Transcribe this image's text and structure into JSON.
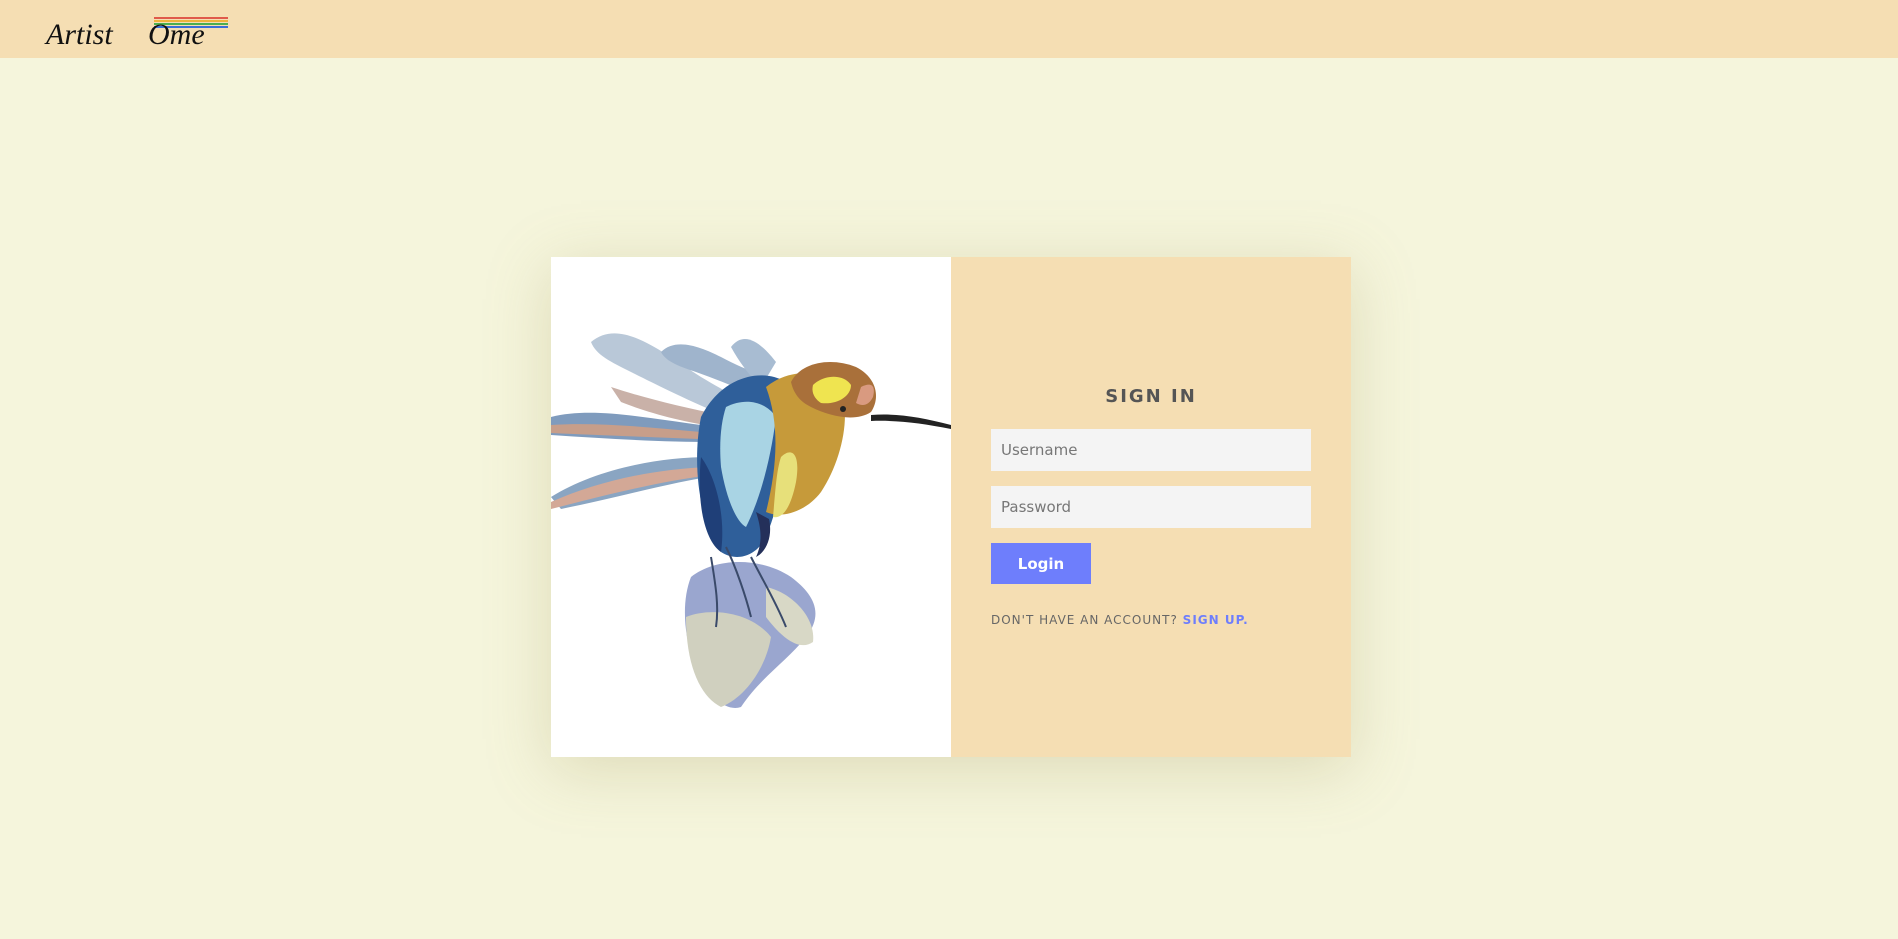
{
  "header": {
    "logo_text": "ArtistOme"
  },
  "login": {
    "title": "SIGN IN",
    "username_placeholder": "Username",
    "password_placeholder": "Password",
    "login_label": "Login",
    "prompt": "DON'T HAVE AN ACCOUNT?",
    "signup_label": "SIGN UP."
  },
  "colors": {
    "page_bg": "#f5f5dc",
    "panel_bg": "#f5deb3",
    "accent": "#6e7efc"
  }
}
